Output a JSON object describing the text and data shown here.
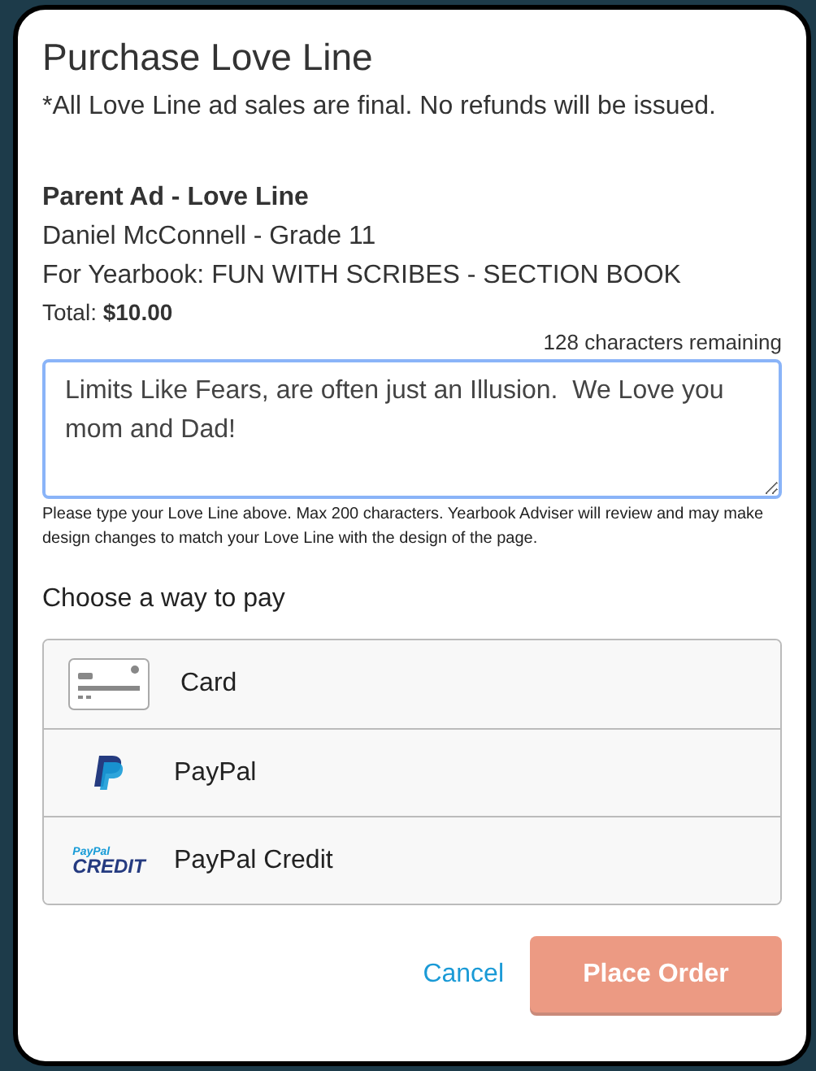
{
  "dialog": {
    "title": "Purchase Love Line",
    "notice": "*All Love Line ad sales are final. No refunds will be issued."
  },
  "item": {
    "name": "Parent Ad - Love Line",
    "student": "Daniel McConnell - Grade 11",
    "yearbook": "For Yearbook: FUN WITH SCRIBES - SECTION BOOK",
    "total": "Total: **$10.00**"
  },
  "message": {
    "counter": "128 characters remaining",
    "value": "Limits Like Fears, are often just an Illusion.  We Love you mom and Dad!",
    "focused": true,
    "help": "Please type your Love Line above. Max 200 characters. Yearbook Adviser will review and may make design changes to match your Love Line with the design of the page."
  },
  "payment": {
    "heading": "Choose a way to pay",
    "options": [
      {
        "kind": "card",
        "label": "Card"
      },
      {
        "kind": "paypal",
        "label": "PayPal"
      },
      {
        "kind": "credit",
        "label": "PayPal Credit",
        "logo_top": "PayPal",
        "logo_bottom": "CREDIT"
      }
    ]
  },
  "buttons": {
    "cancel": "Cancel",
    "submit": {
      "label": "Place Order",
      "disabled": true
    }
  }
}
